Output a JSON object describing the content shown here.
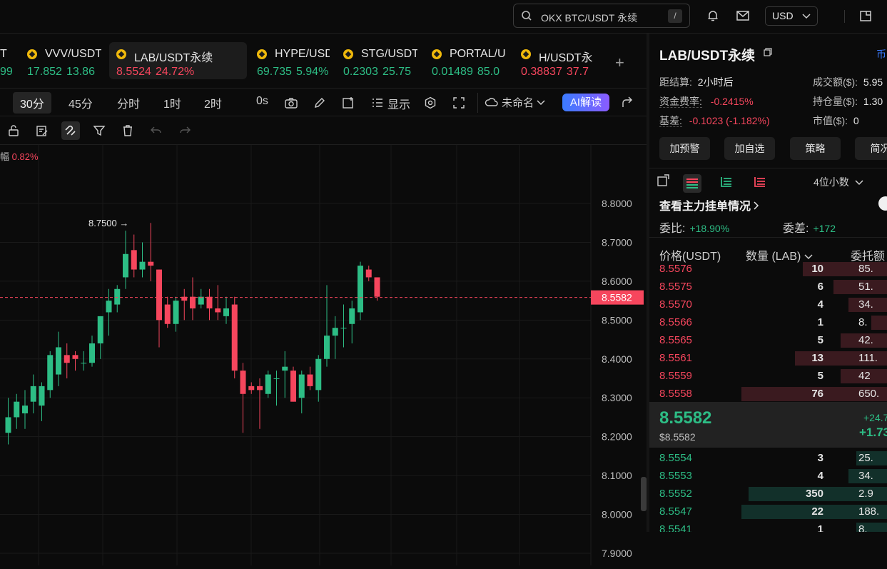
{
  "topbar": {
    "search_placeholder": "OKX BTC/USDT 永续",
    "search_shortcut": "/",
    "currency": "USD",
    "icons": [
      "bell-icon",
      "mail-icon",
      "window-icon"
    ]
  },
  "tabs": [
    {
      "name": "T",
      "price": "99",
      "change": "",
      "direction": "up"
    },
    {
      "name": "VVV/USDT",
      "price": "17.852",
      "change": "13.86",
      "direction": "up"
    },
    {
      "name": "LAB/USDT永续",
      "price": "8.5524",
      "change": "24.72%",
      "direction": "down",
      "active": true
    },
    {
      "name": "HYPE/USD",
      "price": "69.735",
      "change": "5.94%",
      "direction": "up"
    },
    {
      "name": "STG/USDT",
      "price": "0.2303",
      "change": "25.75",
      "direction": "up"
    },
    {
      "name": "PORTAL/U",
      "price": "0.01489",
      "change": "85.0",
      "direction": "up"
    },
    {
      "name": "H/USDT永",
      "price": "0.38837",
      "change": "37.7",
      "direction": "down"
    }
  ],
  "add_tab": "+",
  "toolbar": {
    "timeframes": [
      "30分",
      "45分",
      "分时",
      "1时",
      "2时"
    ],
    "selected_timeframe": "30分",
    "countdown": "0s",
    "display_label": "显示",
    "layout_name": "未命名",
    "ai_label": "AI解读"
  },
  "chart_info": {
    "label": "幅",
    "value": "0.82%"
  },
  "chart_data": {
    "type": "candlestick",
    "y_ticks": [
      "8.8000",
      "8.7000",
      "8.6000",
      "8.5000",
      "8.4000",
      "8.3000",
      "8.2000",
      "8.1000",
      "8.0000",
      "7.9000"
    ],
    "ylim": [
      7.9,
      8.8
    ],
    "current_price": "8.5582",
    "high_marker": "8.7500",
    "candles": [
      [
        8.21,
        8.25,
        8.3,
        8.18
      ],
      [
        8.25,
        8.29,
        8.31,
        8.22
      ],
      [
        8.26,
        8.28,
        8.32,
        8.22
      ],
      [
        8.29,
        8.33,
        8.36,
        8.26
      ],
      [
        8.28,
        8.33,
        8.34,
        8.24
      ],
      [
        8.32,
        8.41,
        8.42,
        8.3
      ],
      [
        8.36,
        8.43,
        8.47,
        8.33
      ],
      [
        8.41,
        8.39,
        8.44,
        8.35
      ],
      [
        8.41,
        8.4,
        8.42,
        8.37
      ],
      [
        8.39,
        8.39,
        8.42,
        8.37
      ],
      [
        8.39,
        8.44,
        8.46,
        8.38
      ],
      [
        8.44,
        8.51,
        8.51,
        8.4
      ],
      [
        8.52,
        8.55,
        8.58,
        8.46
      ],
      [
        8.54,
        8.58,
        8.59,
        8.52
      ],
      [
        8.61,
        8.67,
        8.73,
        8.58
      ],
      [
        8.68,
        8.63,
        8.72,
        8.61
      ],
      [
        8.63,
        8.65,
        8.7,
        8.61
      ],
      [
        8.65,
        8.64,
        8.75,
        8.6
      ],
      [
        8.63,
        8.5,
        8.63,
        8.43
      ],
      [
        8.54,
        8.49,
        8.56,
        8.48
      ],
      [
        8.49,
        8.55,
        8.56,
        8.47
      ],
      [
        8.56,
        8.55,
        8.58,
        8.5
      ],
      [
        8.56,
        8.53,
        8.61,
        8.5
      ],
      [
        8.54,
        8.56,
        8.58,
        8.53
      ],
      [
        8.56,
        8.53,
        8.58,
        8.5
      ],
      [
        8.53,
        8.52,
        8.59,
        8.5
      ],
      [
        8.51,
        8.53,
        8.56,
        8.49
      ],
      [
        8.54,
        8.37,
        8.56,
        8.35
      ],
      [
        8.37,
        8.31,
        8.39,
        8.21
      ],
      [
        8.33,
        8.32,
        8.34,
        8.31
      ],
      [
        8.33,
        8.32,
        8.35,
        8.22
      ],
      [
        8.31,
        8.36,
        8.37,
        8.3
      ],
      [
        8.35,
        8.35,
        8.37,
        8.28
      ],
      [
        8.37,
        8.38,
        8.42,
        8.3
      ],
      [
        8.37,
        8.29,
        8.38,
        8.29
      ],
      [
        8.3,
        8.36,
        8.37,
        8.26
      ],
      [
        8.36,
        8.33,
        8.38,
        8.32
      ],
      [
        8.32,
        8.4,
        8.41,
        8.29
      ],
      [
        8.4,
        8.46,
        8.59,
        8.38
      ],
      [
        8.46,
        8.48,
        8.51,
        8.4
      ],
      [
        8.48,
        8.48,
        8.54,
        8.43
      ],
      [
        8.49,
        8.53,
        8.55,
        8.44
      ],
      [
        8.52,
        8.64,
        8.65,
        8.5
      ],
      [
        8.63,
        8.61,
        8.64,
        8.6
      ],
      [
        8.61,
        8.56,
        8.61,
        8.55
      ]
    ]
  },
  "symbol_panel": {
    "title": "LAB/USDT永续",
    "link": "币",
    "settlement_label": "距结算:",
    "settlement_value": "2小时后",
    "turnover_label": "成交额($):",
    "turnover_value": "5.95",
    "funding_label": "资金费率:",
    "funding_value": "-0.2415%",
    "oi_label": "持仓量($):",
    "oi_value": "1.30",
    "basis_label": "基差:",
    "basis_value": "-0.1023 (-1.182%)",
    "mcap_label": "市值($):",
    "mcap_value": "0",
    "buttons": [
      "加预警",
      "加自选",
      "策略",
      "简况"
    ]
  },
  "orderbook": {
    "decimals": "4位小数",
    "main_orders": "查看主力挂单情况",
    "ratio_label": "委比:",
    "ratio_value": "+18.90%",
    "diff_label": "委差:",
    "diff_value": "+172",
    "col_price": "价格(USDT)",
    "col_qty": "数量 (LAB)",
    "col_total": "委托额",
    "asks": [
      {
        "price": "8.5576",
        "qty": "10",
        "total": "85.",
        "depth": 0.55
      },
      {
        "price": "8.5575",
        "qty": "6",
        "total": "51.",
        "depth": 0.35
      },
      {
        "price": "8.5570",
        "qty": "4",
        "total": "34.",
        "depth": 0.25
      },
      {
        "price": "8.5566",
        "qty": "1",
        "total": "8.",
        "depth": 0.1
      },
      {
        "price": "8.5565",
        "qty": "5",
        "total": "42.",
        "depth": 0.3
      },
      {
        "price": "8.5561",
        "qty": "13",
        "total": "111.",
        "depth": 0.6
      },
      {
        "price": "8.5559",
        "qty": "5",
        "total": "42",
        "depth": 0.3
      },
      {
        "price": "8.5558",
        "qty": "76",
        "total": "650.",
        "depth": 0.95
      }
    ],
    "mid_price": "8.5582",
    "mid_usd": "$8.5582",
    "mid_change_pct": "+24.7",
    "mid_change_abs": "+1.73",
    "bids": [
      {
        "price": "8.5554",
        "qty": "3",
        "total": "25.",
        "depth": 0.2
      },
      {
        "price": "8.5553",
        "qty": "4",
        "total": "34.",
        "depth": 0.25
      },
      {
        "price": "8.5552",
        "qty": "350",
        "total": "2.9",
        "depth": 0.9
      },
      {
        "price": "8.5547",
        "qty": "22",
        "total": "188.",
        "depth": 0.95
      },
      {
        "price": "8.5541",
        "qty": "1",
        "total": "8.",
        "depth": 0.2
      }
    ]
  }
}
